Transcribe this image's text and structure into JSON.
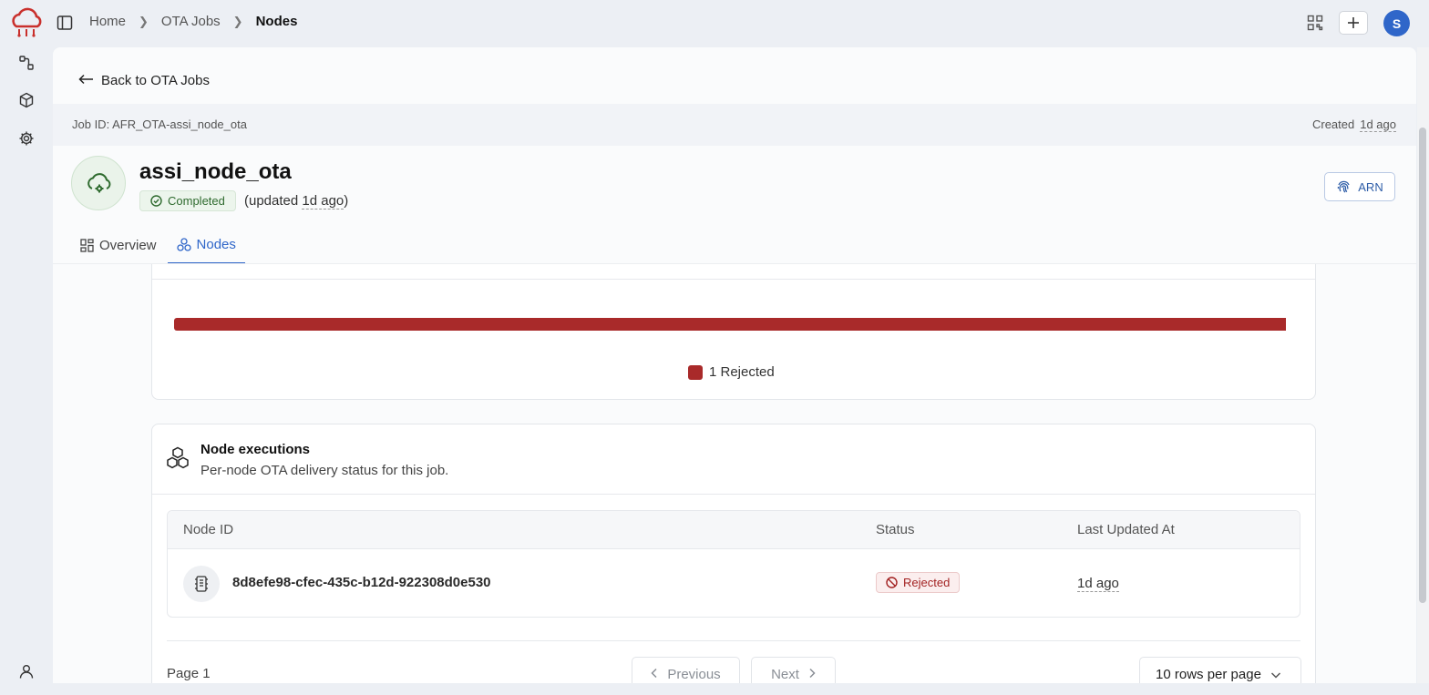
{
  "colors": {
    "accent": "#2f66c9",
    "success": "#2f6b2f",
    "rejected": "#a92a2a"
  },
  "breadcrumb": {
    "home": "Home",
    "jobs": "OTA Jobs",
    "current": "Nodes"
  },
  "header": {
    "avatar_initial": "S"
  },
  "back_link": "Back to OTA Jobs",
  "job": {
    "id_label": "Job ID: AFR_OTA-assi_node_ota",
    "created_label": "Created",
    "created_ago": "1d ago",
    "title": "assi_node_ota",
    "status": "Completed",
    "updated_prefix": "(updated ",
    "updated_ago": "1d ago",
    "updated_suffix": ")",
    "arn_label": "ARN"
  },
  "tabs": [
    {
      "label": "Overview",
      "icon": "grid-icon",
      "active": false
    },
    {
      "label": "Nodes",
      "icon": "nodes-icon",
      "active": true
    }
  ],
  "progress": {
    "rejected_fraction": 1.0,
    "legend": "1 Rejected"
  },
  "executions": {
    "title": "Node executions",
    "subtitle": "Per-node OTA delivery status for this job.",
    "columns": [
      "Node ID",
      "Status",
      "Last Updated At"
    ],
    "rows": [
      {
        "node_id": "8d8efe98-cfec-435c-b12d-922308d0e530",
        "status": "Rejected",
        "last_updated": "1d ago"
      }
    ],
    "page_label": "Page 1",
    "prev_label": "Previous",
    "next_label": "Next",
    "rows_per_page": "10 rows per page"
  }
}
